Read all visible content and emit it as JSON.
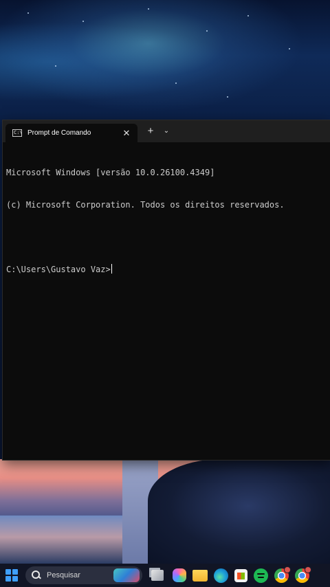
{
  "window": {
    "tab_title": "Prompt de Comando",
    "tab_icon_text": "C:\\",
    "close_glyph": "✕",
    "new_tab_glyph": "+",
    "dropdown_glyph": "⌄"
  },
  "console": {
    "lines": [
      "Microsoft Windows [versão 10.0.26100.4349]",
      "(c) Microsoft Corporation. Todos os direitos reservados.",
      "",
      "C:\\Users\\Gustavo Vaz>"
    ]
  },
  "taskbar": {
    "search_placeholder": "Pesquisar",
    "icons": [
      "windows-start-icon",
      "search-icon",
      "task-view-icon",
      "copilot-icon",
      "file-explorer-icon",
      "edge-icon",
      "microsoft-store-icon",
      "spotify-icon",
      "chrome-icon",
      "chrome-profile-icon"
    ]
  }
}
